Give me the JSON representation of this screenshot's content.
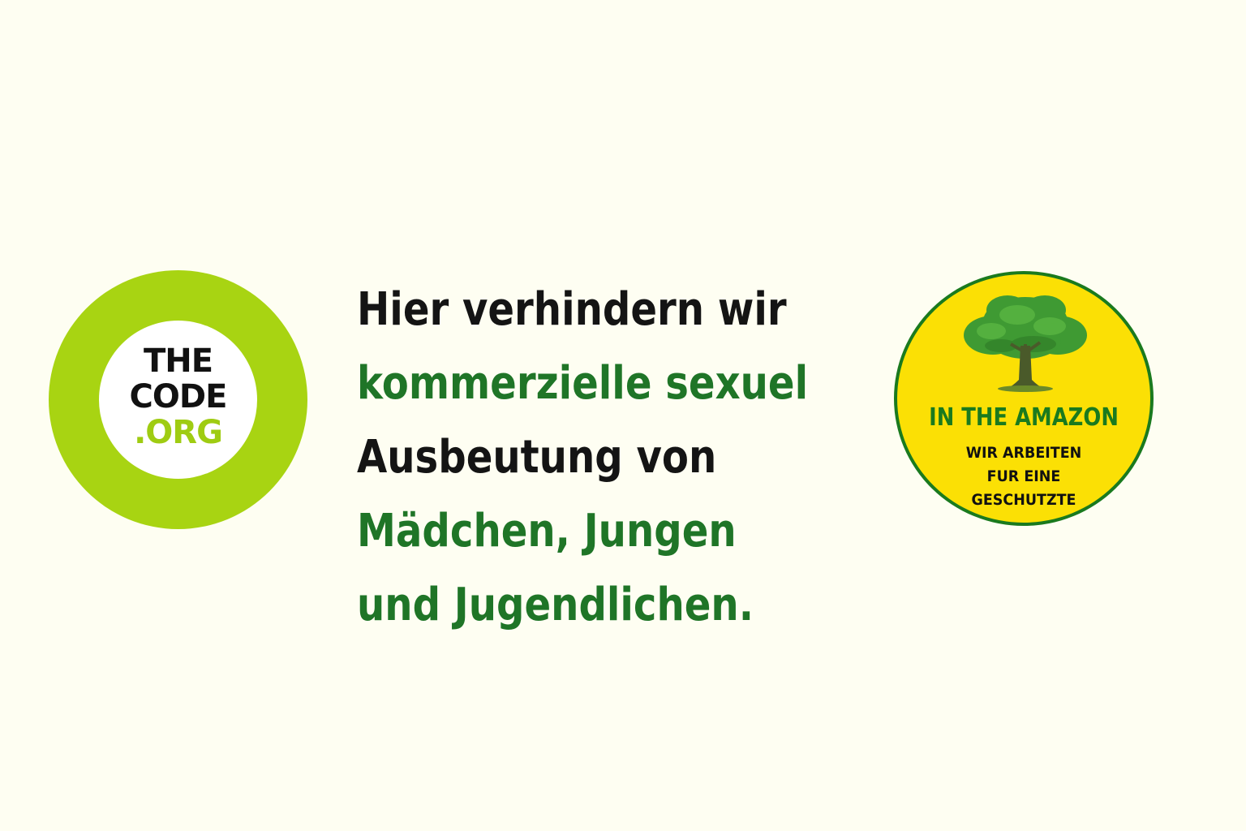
{
  "code_logo": {
    "line1": "THE",
    "line2": "CODE",
    "line3": ".ORG"
  },
  "headline": {
    "line1": "Hier verhindern wir",
    "line2": "kommerzielle sexuel",
    "line3": "Ausbeutung von",
    "line4": "Mädchen, Jungen",
    "line5": "und Jugendlichen."
  },
  "amazon_badge": {
    "title": "IN THE AMAZON",
    "sub1": "WIR ARBEITEN",
    "sub2": "FUR EINE",
    "sub3": "GESCHUTZTE",
    "icon": "tree-icon"
  },
  "colors": {
    "background": "#fefef2",
    "lime": "#a8d412",
    "green": "#1f7527",
    "yellow": "#fbe005"
  }
}
